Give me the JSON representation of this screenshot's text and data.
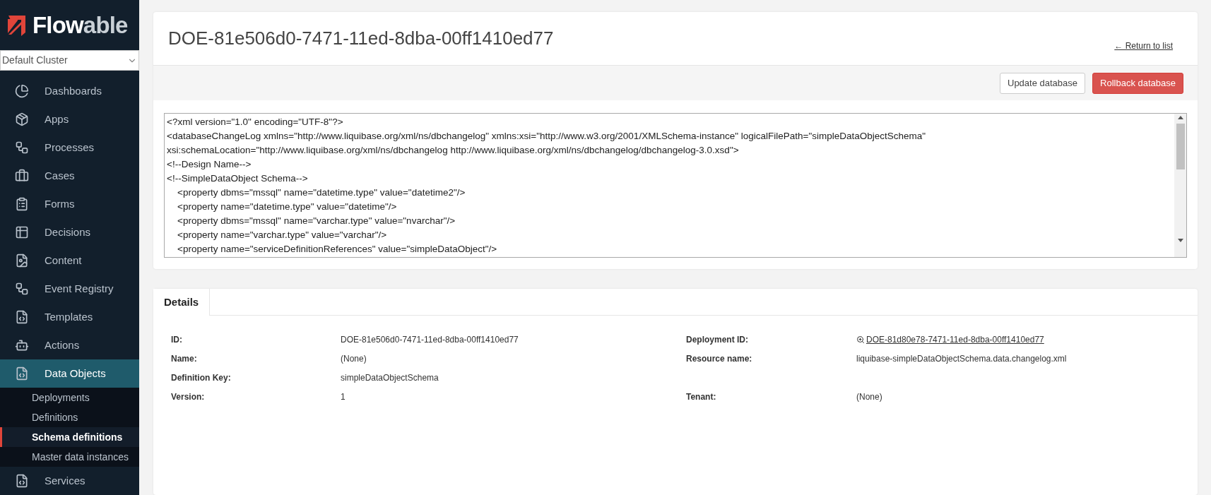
{
  "logo": {
    "primary": "Flow",
    "secondary": "able"
  },
  "cluster_select": {
    "value": "Default Cluster"
  },
  "sidebar": {
    "items": [
      {
        "label": "Dashboards",
        "kind": "dashboards",
        "selected": false
      },
      {
        "label": "Apps",
        "kind": "apps",
        "selected": false
      },
      {
        "label": "Processes",
        "kind": "processes",
        "selected": false
      },
      {
        "label": "Cases",
        "kind": "cases",
        "selected": false
      },
      {
        "label": "Forms",
        "kind": "forms",
        "selected": false
      },
      {
        "label": "Decisions",
        "kind": "decisions",
        "selected": false
      },
      {
        "label": "Content",
        "kind": "content",
        "selected": false
      },
      {
        "label": "Event Registry",
        "kind": "processes",
        "selected": false
      },
      {
        "label": "Templates",
        "kind": "code",
        "selected": false
      },
      {
        "label": "Actions",
        "kind": "actions",
        "selected": false
      },
      {
        "label": "Data Objects",
        "kind": "code",
        "selected": true,
        "children": [
          {
            "label": "Deployments",
            "selected": false
          },
          {
            "label": "Definitions",
            "selected": false
          },
          {
            "label": "Schema definitions",
            "selected": true
          },
          {
            "label": "Master data instances",
            "selected": false
          }
        ]
      },
      {
        "label": "Services",
        "kind": "code",
        "selected": false
      }
    ]
  },
  "header": {
    "title": "DOE-81e506d0-7471-11ed-8dba-00ff1410ed77",
    "return_link": "← Return to list"
  },
  "toolbar": {
    "buttons": [
      {
        "label": "Update database",
        "kind": "default"
      },
      {
        "label": "Rollback database",
        "kind": "danger"
      }
    ]
  },
  "xml_editor": {
    "lines": [
      "<?xml version=\"1.0\" encoding=\"UTF-8\"?>",
      "<databaseChangeLog xmlns=\"http://www.liquibase.org/xml/ns/dbchangelog\" xmlns:xsi=\"http://www.w3.org/2001/XMLSchema-instance\" logicalFilePath=\"simpleDataObjectSchema\"",
      "xsi:schemaLocation=\"http://www.liquibase.org/xml/ns/dbchangelog http://www.liquibase.org/xml/ns/dbchangelog/dbchangelog-3.0.xsd\">",
      "<!--Design Name-->",
      "<!--SimpleDataObject Schema-->",
      "    <property dbms=\"mssql\" name=\"datetime.type\" value=\"datetime2\"/>",
      "    <property name=\"datetime.type\" value=\"datetime\"/>",
      "    <property dbms=\"mssql\" name=\"varchar.type\" value=\"nvarchar\"/>",
      "    <property name=\"varchar.type\" value=\"varchar\"/>",
      "    <property name=\"serviceDefinitionReferences\" value=\"simpleDataObject\"/>"
    ]
  },
  "details": {
    "tabs": [
      {
        "label": "Details",
        "selected": true
      }
    ],
    "left": [
      {
        "label": "ID:",
        "value": "DOE-81e506d0-7471-11ed-8dba-00ff1410ed77"
      },
      {
        "label": "Name:",
        "value": "(None)"
      },
      {
        "label": "Definition Key:",
        "value": "simpleDataObjectSchema"
      },
      {
        "label": "Version:",
        "value": "1"
      }
    ],
    "right": [
      {
        "label": "Deployment ID:",
        "value": "DOE-81d80e78-7471-11ed-8dba-00ff1410ed77",
        "kind": "link"
      },
      {
        "label": "Resource name:",
        "value": "liquibase-simpleDataObjectSchema.data.changelog.xml",
        "kind": "text"
      },
      {
        "kind": "empty"
      },
      {
        "label": "Tenant:",
        "value": "(None)",
        "kind": "text"
      }
    ]
  }
}
